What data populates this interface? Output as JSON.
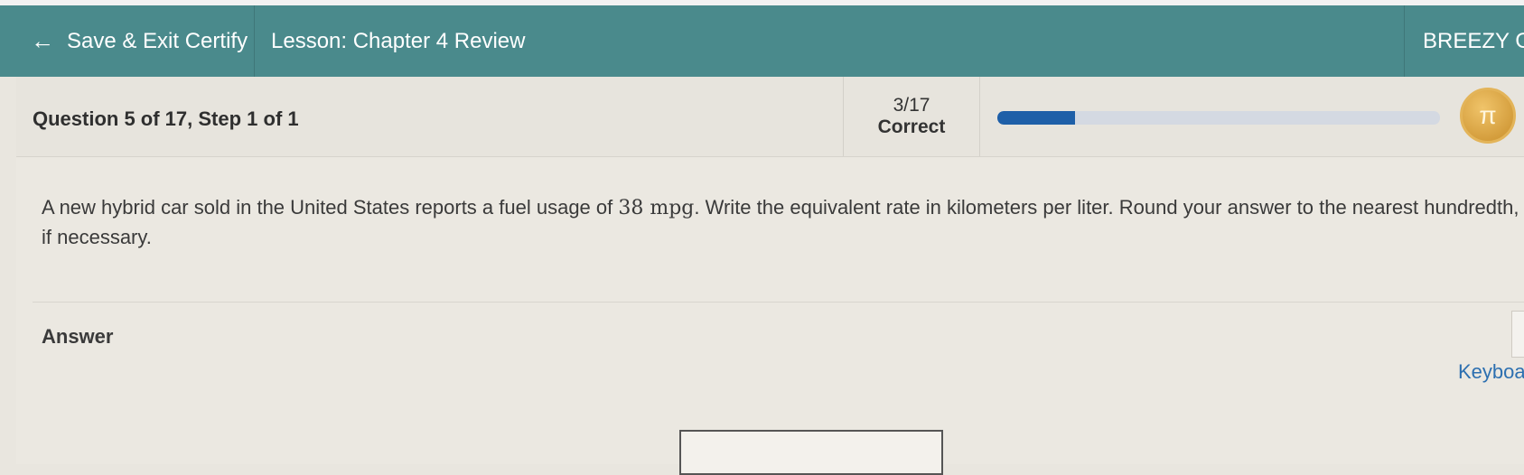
{
  "header": {
    "back_label": "Save & Exit Certify",
    "lesson_title": "Lesson: Chapter 4 Review",
    "user_name": "BREEZY GR"
  },
  "progress": {
    "question_label": "Question 5 of 17, Step 1 of 1",
    "score_count": "3/17",
    "score_label": "Correct",
    "fraction_correct": 0.176
  },
  "question": {
    "text_before": "A new hybrid car sold in the United States reports a fuel usage of ",
    "math_value": "38 mpg",
    "text_after": ". Write the equivalent rate in kilometers per liter. Round your answer to the nearest hundredth, if necessary."
  },
  "answer": {
    "label": "Answer",
    "keyboard_label": "Keyboard",
    "input_value": ""
  },
  "colors": {
    "header_bg": "#4a8a8c",
    "progress_fill": "#1e5fa8",
    "link": "#2c6fb0"
  }
}
